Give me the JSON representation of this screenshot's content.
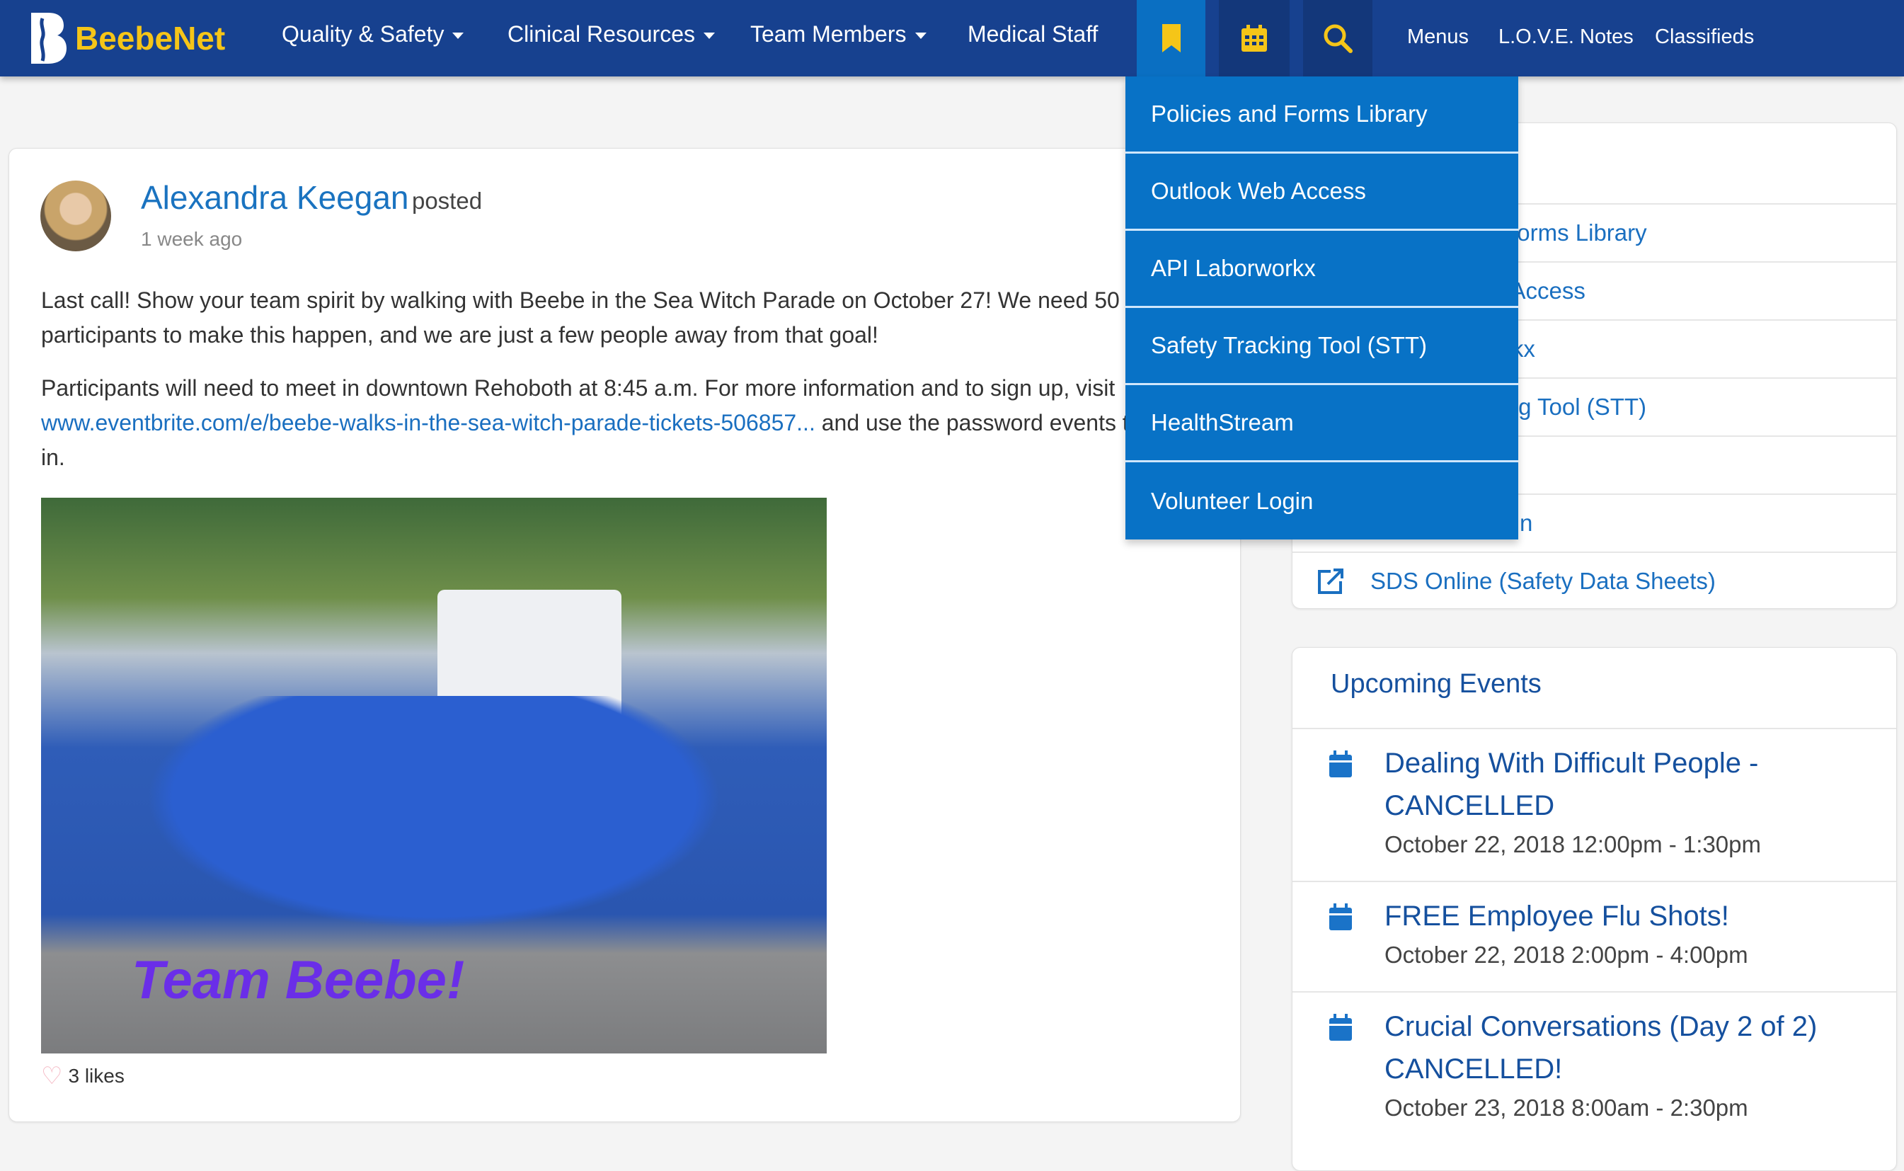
{
  "nav": {
    "logo_text": "BeebeNet",
    "items": [
      {
        "label": "Quality & Safety",
        "dropdown": true
      },
      {
        "label": "Clinical Resources",
        "dropdown": true
      },
      {
        "label": "Team Members",
        "dropdown": true
      },
      {
        "label": "Medical Staff",
        "dropdown": false
      }
    ],
    "icon_tabs": [
      "bookmark-icon",
      "calendar-icon",
      "search-icon"
    ],
    "right_links": [
      "Menus",
      "L.O.V.E. Notes",
      "Classifieds"
    ],
    "colors": {
      "bar": "#17418f",
      "active_tab": "#0a6fc2",
      "logo_yellow": "#f5c518"
    }
  },
  "bookmark_dropdown": {
    "items": [
      "Policies and Forms Library",
      "Outlook Web Access",
      "API Laborworkx",
      "Safety Tracking Tool (STT)",
      "HealthStream",
      "Volunteer Login"
    ]
  },
  "post": {
    "author": "Alexandra Keegan",
    "action": "posted",
    "time": "1 week ago",
    "para1": "Last call! Show your team spirit by walking with Beebe in the Sea Witch Parade on October 27! We need 50 participants to make this happen, and we are just a few people away from that goal!",
    "para2_start": "Participants will need to meet in downtown Rehoboth at 8:45 a.m. For more information and to sign up, visit ",
    "para2_link": "www.eventbrite.com/e/beebe-walks-in-the-sea-witch-parade-tickets-506857...",
    "para2_end": " and use the password events to log in.",
    "image_caption": "Team Beebe!",
    "likes": "3 likes"
  },
  "quick_links": {
    "items": [
      "Policies and Forms Library",
      "Outlook Web Access",
      "API Laborworkx",
      "Safety Tracking Tool (STT)",
      "HealthStream",
      "Volunteer Login",
      "SDS Online (Safety Data Sheets)"
    ]
  },
  "events": {
    "title": "Upcoming Events",
    "items": [
      {
        "title": "Dealing With Difficult People - CANCELLED",
        "date": "October 22, 2018 12:00pm - 1:30pm"
      },
      {
        "title": "FREE Employee Flu Shots!",
        "date": "October 22, 2018 2:00pm - 4:00pm"
      },
      {
        "title": "Crucial Conversations (Day 2 of 2) CANCELLED!",
        "date": "October 23, 2018 8:00am - 2:30pm"
      }
    ]
  }
}
